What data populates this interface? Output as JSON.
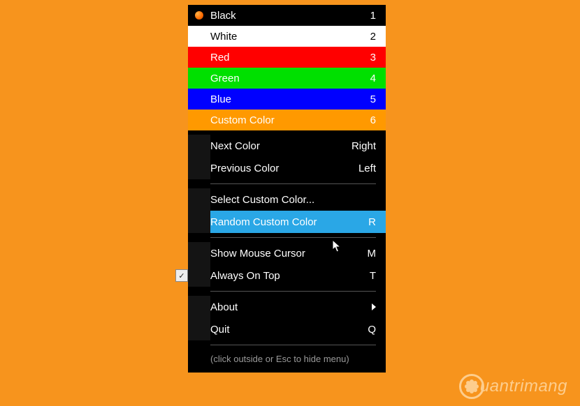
{
  "colors": [
    {
      "name": "Black",
      "shortcut": "1",
      "css": "row-black",
      "icon": true
    },
    {
      "name": "White",
      "shortcut": "2",
      "css": "row-white",
      "icon": false
    },
    {
      "name": "Red",
      "shortcut": "3",
      "css": "row-red",
      "icon": false
    },
    {
      "name": "Green",
      "shortcut": "4",
      "css": "row-green",
      "icon": false
    },
    {
      "name": "Blue",
      "shortcut": "5",
      "css": "row-blue",
      "icon": false
    },
    {
      "name": "Custom Color",
      "shortcut": "6",
      "css": "row-custom",
      "icon": false
    }
  ],
  "nav": {
    "next_label": "Next Color",
    "next_shortcut": "Right",
    "prev_label": "Previous Color",
    "prev_shortcut": "Left"
  },
  "custom": {
    "select_label": "Select Custom Color...",
    "random_label": "Random Custom Color",
    "random_shortcut": "R"
  },
  "options": {
    "cursor_label": "Show Mouse Cursor",
    "cursor_shortcut": "M",
    "ontop_label": "Always On Top",
    "ontop_shortcut": "T",
    "ontop_check": "✓"
  },
  "meta": {
    "about_label": "About",
    "quit_label": "Quit",
    "quit_shortcut": "Q"
  },
  "hint": "(click outside or Esc to hide menu)",
  "watermark": "uantrimang"
}
